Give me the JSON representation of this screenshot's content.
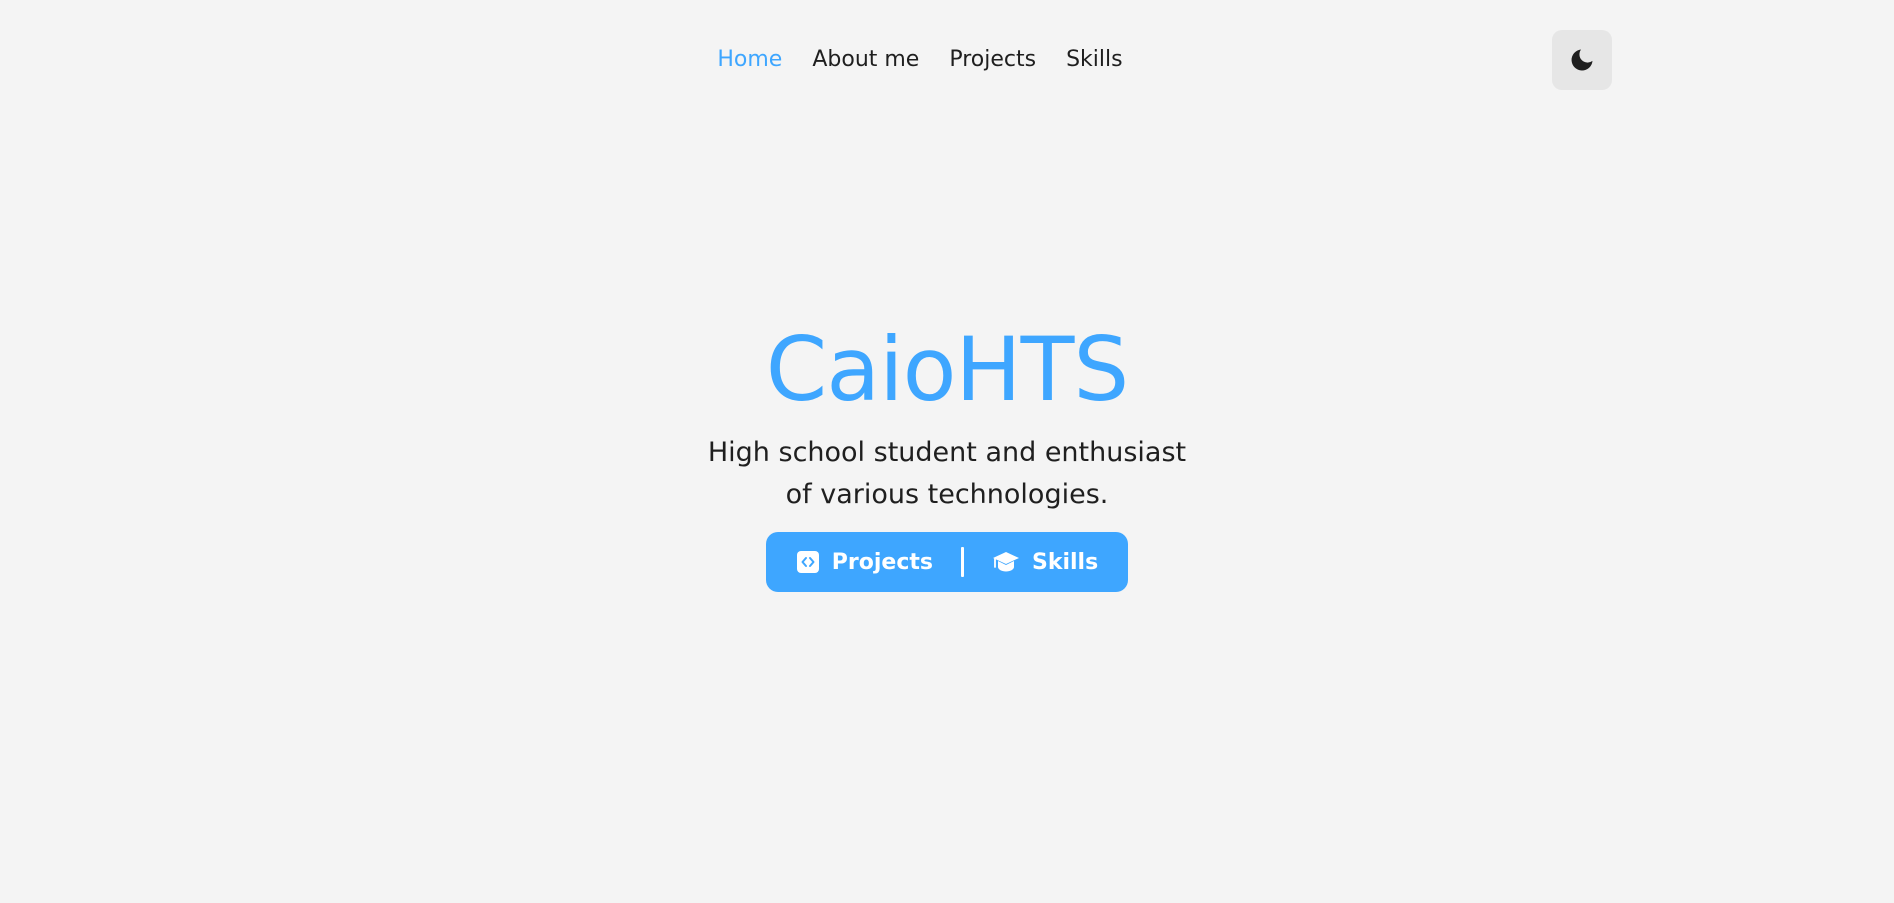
{
  "nav": {
    "links": [
      {
        "label": "Home",
        "active": true
      },
      {
        "label": "About me",
        "active": false
      },
      {
        "label": "Projects",
        "active": false
      },
      {
        "label": "Skills",
        "active": false
      }
    ],
    "theme_toggle_icon": "moon-icon"
  },
  "hero": {
    "title": "CaioHTS",
    "subtitle": "High school student and enthusiast of various technologies.",
    "buttons": [
      {
        "label": "Projects",
        "icon": "code-icon"
      },
      {
        "label": "Skills",
        "icon": "graduation-cap-icon"
      }
    ]
  },
  "colors": {
    "accent": "#3ea6ff",
    "background": "#f4f4f4",
    "text": "#1f1f1f",
    "toggle_bg": "#e6e6e6"
  }
}
